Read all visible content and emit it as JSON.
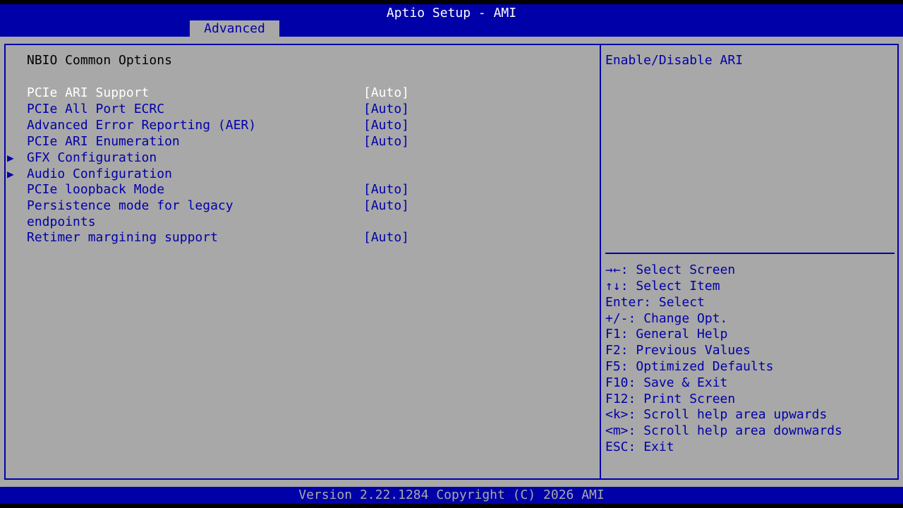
{
  "header": {
    "title": "Aptio Setup - AMI",
    "active_tab": "Advanced"
  },
  "page": {
    "section_title": "NBIO Common Options"
  },
  "settings": [
    {
      "label": "PCIe ARI Support",
      "value": "[Auto]"
    },
    {
      "label": "PCIe All Port ECRC",
      "value": "[Auto]"
    },
    {
      "label": "Advanced Error Reporting (AER)",
      "value": "[Auto]"
    },
    {
      "label": "PCIe ARI Enumeration",
      "value": "[Auto]"
    },
    {
      "label": "GFX Configuration"
    },
    {
      "label": "Audio Configuration"
    },
    {
      "label": "PCIe loopback Mode",
      "value": "[Auto]"
    },
    {
      "label": "Persistence mode for legacy",
      "label_cont": "endpoints",
      "value": "[Auto]"
    },
    {
      "label": "Retimer margining support",
      "value": "[Auto]"
    }
  ],
  "submenu_marker": "▶",
  "help": {
    "text": "Enable/Disable ARI"
  },
  "keys": [
    {
      "key": "→←",
      "desc": ": Select Screen"
    },
    {
      "key": "↑↓",
      "desc": ": Select Item"
    },
    {
      "key": "Enter",
      "desc": ": Select"
    },
    {
      "key": "+/-",
      "desc": ": Change Opt."
    },
    {
      "key": "F1",
      "desc": ": General Help"
    },
    {
      "key": "F2",
      "desc": ": Previous Values"
    },
    {
      "key": "F5",
      "desc": ": Optimized Defaults"
    },
    {
      "key": "F10",
      "desc": ": Save & Exit"
    },
    {
      "key": "F12",
      "desc": ": Print Screen"
    },
    {
      "key": "<k>",
      "desc": ": Scroll help area upwards"
    },
    {
      "key": "<m>",
      "desc": ": Scroll help area downwards"
    },
    {
      "key": "ESC",
      "desc": ": Exit"
    }
  ],
  "footer": {
    "version": "Version 2.22.1284 Copyright (C) 2026 AMI"
  }
}
